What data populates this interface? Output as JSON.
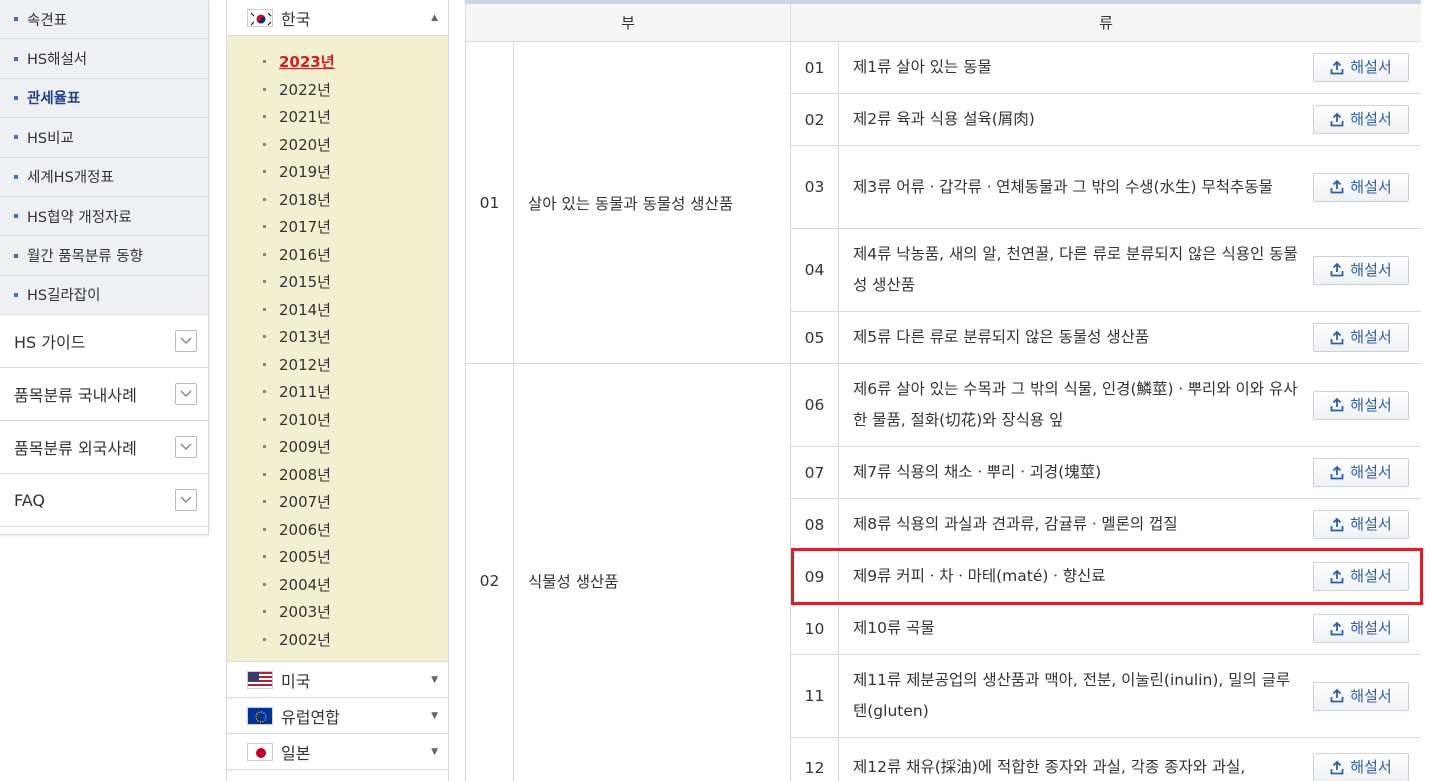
{
  "sidebar": {
    "sub_items": [
      {
        "label": "속견표",
        "active": false
      },
      {
        "label": "HS해설서",
        "active": false
      },
      {
        "label": "관세율표",
        "active": true
      },
      {
        "label": "HS비교",
        "active": false
      },
      {
        "label": "세계HS개정표",
        "active": false
      },
      {
        "label": "HS협약 개정자료",
        "active": false
      },
      {
        "label": "월간 품목분류 동향",
        "active": false
      },
      {
        "label": "HS길라잡이",
        "active": false
      }
    ],
    "menus": [
      {
        "label": "HS 가이드"
      },
      {
        "label": "품목분류 국내사례"
      },
      {
        "label": "품목분류 외국사례"
      },
      {
        "label": "FAQ"
      }
    ]
  },
  "year_panel": {
    "selected_country": "한국",
    "years": [
      "2023년",
      "2022년",
      "2021년",
      "2020년",
      "2019년",
      "2018년",
      "2017년",
      "2016년",
      "2015년",
      "2014년",
      "2013년",
      "2012년",
      "2011년",
      "2010년",
      "2009년",
      "2008년",
      "2007년",
      "2006년",
      "2005년",
      "2004년",
      "2003년",
      "2002년"
    ],
    "active_year": "2023년",
    "other_countries": [
      "미국",
      "유럽연합",
      "일본"
    ]
  },
  "table": {
    "headers": {
      "bu": "부",
      "ryu": "류"
    },
    "button_label": "해설서",
    "sections": [
      {
        "num": "01",
        "name": "살아 있는 동물과 동물성 생산품",
        "rows": [
          {
            "num": "01",
            "name": "제1류 살아 있는 동물"
          },
          {
            "num": "02",
            "name": "제2류 육과 식용 설육(屑肉)"
          },
          {
            "num": "03",
            "name": "제3류 어류ㆍ갑각류ㆍ연체동물과 그 밖의 수생(水生) 무척추동물"
          },
          {
            "num": "04",
            "name": "제4류 낙농품, 새의 알, 천연꿀, 다른 류로 분류되지 않은 식용인 동물성 생산품"
          },
          {
            "num": "05",
            "name": "제5류 다른 류로 분류되지 않은 동물성 생산품"
          }
        ]
      },
      {
        "num": "02",
        "name": "식물성 생산품",
        "rows": [
          {
            "num": "06",
            "name": "제6류 살아 있는 수목과 그 밖의 식물, 인경(鱗莖)ㆍ뿌리와 이와 유사한 물품, 절화(切花)와 장식용 잎"
          },
          {
            "num": "07",
            "name": "제7류 식용의 채소ㆍ뿌리ㆍ괴경(塊莖)"
          },
          {
            "num": "08",
            "name": "제8류 식용의 과실과 견과류, 감귤류ㆍ멜론의 껍질"
          },
          {
            "num": "09",
            "name": "제9류 커피ㆍ차ㆍ마테(maté)ㆍ향신료"
          },
          {
            "num": "10",
            "name": "제10류 곡물"
          },
          {
            "num": "11",
            "name": "제11류 제분공업의 생산품과 맥아, 전분, 이눌린(inulin), 밀의 글루텐(gluten)"
          },
          {
            "num": "12",
            "name": "제12류 채유(採油)에 적합한 종자와 과실, 각종 종자와 과실,"
          }
        ]
      }
    ]
  },
  "colors": {
    "highlight": "#d4222a",
    "active_year": "#d11f1f",
    "button_text": "#2e5ea7",
    "year_bg": "#f3f0d2"
  }
}
